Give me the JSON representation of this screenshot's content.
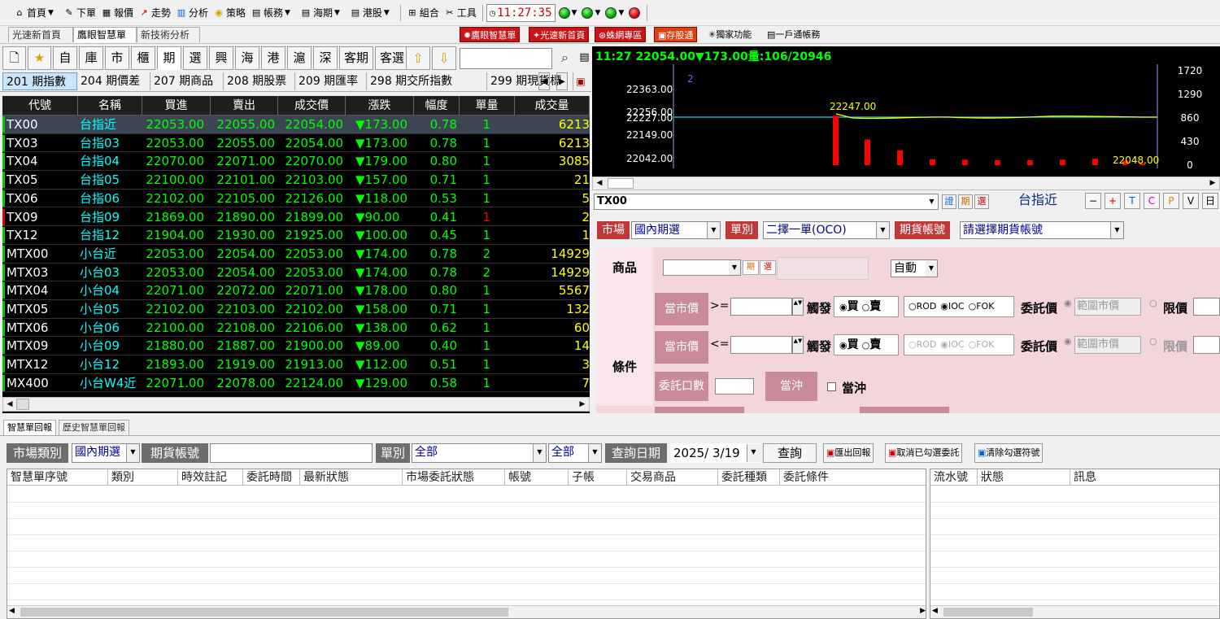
{
  "toolbar": {
    "items": [
      "首頁",
      "下單",
      "報價",
      "走勢",
      "分析",
      "策略",
      "帳務",
      "海期",
      "港股",
      "組合",
      "工具"
    ],
    "clock": "11:27:35"
  },
  "toolbar2": {
    "tabs": [
      "光速新首頁",
      "鷹眼智慧單",
      "新技術分析"
    ],
    "buttons": [
      "鷹眼智慧單",
      "光速新首頁",
      "蛛網專區",
      "存股通",
      "獨家功能",
      "一戶通帳務"
    ]
  },
  "nav": {
    "tabs": [
      "自",
      "庫",
      "市",
      "櫃",
      "期",
      "選",
      "興",
      "海",
      "港",
      "滬",
      "深",
      "客期",
      "客選"
    ],
    "subtabs": [
      "201 期指數",
      "204 期價差",
      "207 期商品",
      "208 期股票",
      "209 期匯率",
      "298 期交所指數",
      "299 期現貨標"
    ]
  },
  "quote_table": {
    "headers": [
      "代號",
      "名稱",
      "買進",
      "賣出",
      "成交價",
      "漲跌",
      "幅度",
      "單量",
      "成交量"
    ],
    "rows": [
      {
        "code": "TX00",
        "name": "台指近",
        "bid": "22053.00",
        "ask": "22055.00",
        "last": "22054.00",
        "chg": "▼173.00",
        "pct": "0.78",
        "qty": "1",
        "vol": "6213"
      },
      {
        "code": "TX03",
        "name": "台指03",
        "bid": "22053.00",
        "ask": "22055.00",
        "last": "22054.00",
        "chg": "▼173.00",
        "pct": "0.78",
        "qty": "1",
        "vol": "6213"
      },
      {
        "code": "TX04",
        "name": "台指04",
        "bid": "22070.00",
        "ask": "22071.00",
        "last": "22070.00",
        "chg": "▼179.00",
        "pct": "0.80",
        "qty": "1",
        "vol": "3085"
      },
      {
        "code": "TX05",
        "name": "台指05",
        "bid": "22100.00",
        "ask": "22101.00",
        "last": "22103.00",
        "chg": "▼157.00",
        "pct": "0.71",
        "qty": "1",
        "vol": "21"
      },
      {
        "code": "TX06",
        "name": "台指06",
        "bid": "22102.00",
        "ask": "22105.00",
        "last": "22126.00",
        "chg": "▼118.00",
        "pct": "0.53",
        "qty": "1",
        "vol": "5"
      },
      {
        "code": "TX09",
        "name": "台指09",
        "bid": "21869.00",
        "ask": "21890.00",
        "last": "21899.00",
        "chg": "▼90.00",
        "pct": "0.41",
        "qty": "1",
        "vol": "2"
      },
      {
        "code": "TX12",
        "name": "台指12",
        "bid": "21904.00",
        "ask": "21930.00",
        "last": "21925.00",
        "chg": "▼100.00",
        "pct": "0.45",
        "qty": "1",
        "vol": "1"
      },
      {
        "code": "MTX00",
        "name": "小台近",
        "bid": "22053.00",
        "ask": "22054.00",
        "last": "22053.00",
        "chg": "▼174.00",
        "pct": "0.78",
        "qty": "2",
        "vol": "14929"
      },
      {
        "code": "MTX03",
        "name": "小台03",
        "bid": "22053.00",
        "ask": "22054.00",
        "last": "22053.00",
        "chg": "▼174.00",
        "pct": "0.78",
        "qty": "2",
        "vol": "14929"
      },
      {
        "code": "MTX04",
        "name": "小台04",
        "bid": "22071.00",
        "ask": "22072.00",
        "last": "22071.00",
        "chg": "▼178.00",
        "pct": "0.80",
        "qty": "1",
        "vol": "5567"
      },
      {
        "code": "MTX05",
        "name": "小台05",
        "bid": "22102.00",
        "ask": "22103.00",
        "last": "22102.00",
        "chg": "▼158.00",
        "pct": "0.71",
        "qty": "1",
        "vol": "132"
      },
      {
        "code": "MTX06",
        "name": "小台06",
        "bid": "22100.00",
        "ask": "22108.00",
        "last": "22106.00",
        "chg": "▼138.00",
        "pct": "0.62",
        "qty": "1",
        "vol": "60"
      },
      {
        "code": "MTX09",
        "name": "小台09",
        "bid": "21880.00",
        "ask": "21887.00",
        "last": "21900.00",
        "chg": "▼89.00",
        "pct": "0.40",
        "qty": "1",
        "vol": "14"
      },
      {
        "code": "MTX12",
        "name": "小台12",
        "bid": "21893.00",
        "ask": "21919.00",
        "last": "21913.00",
        "chg": "▼112.00",
        "pct": "0.51",
        "qty": "1",
        "vol": "3"
      },
      {
        "code": "MX400",
        "name": "小台W4近",
        "bid": "22071.00",
        "ask": "22078.00",
        "last": "22124.00",
        "chg": "▼129.00",
        "pct": "0.58",
        "qty": "1",
        "vol": "7"
      }
    ]
  },
  "chart_data": {
    "type": "line",
    "header": "11:27  22054.00▼173.00量:106/20946",
    "marker": "2",
    "price_ticks": [
      "22363.00",
      "22256.00",
      "22227.00",
      "22149.00",
      "22042.00"
    ],
    "volume_ticks": [
      "1720",
      "1290",
      "860",
      "430",
      "0"
    ],
    "high_label": "22247.00",
    "low_label": "22048.00",
    "volume_bars": [
      1000,
      520,
      300,
      120,
      110,
      100,
      100,
      110,
      130,
      90,
      40
    ]
  },
  "order": {
    "symbol": "TX00",
    "symbol_btns": [
      "證",
      "期",
      "選"
    ],
    "symbol_name": "台指近",
    "icon_btns": [
      "−",
      "+",
      "T",
      "C",
      "P",
      "V",
      "日"
    ],
    "market_label": "市場",
    "market_value": "國內期選",
    "type_label": "單別",
    "type_value": "二擇一單(OCO)",
    "account_label": "期貨帳號",
    "account_value": "請選擇期貨帳號",
    "product_label": "商品",
    "product_btns": [
      "期",
      "選"
    ],
    "trigger_value": "自動",
    "cond_label": "條件",
    "row1": {
      "label": "當市價",
      "op": ">=",
      "trigger": "觸發",
      "buy": "買",
      "sell": "賣",
      "rod": "ROD",
      "ioc": "IOC",
      "fok": "FOK",
      "price_label": "委託價",
      "range": "範圍市價",
      "limit": "限價"
    },
    "row2": {
      "label": "當市價",
      "op": "<=",
      "trigger": "觸發",
      "buy": "買",
      "sell": "賣",
      "rod": "ROD",
      "ioc": "IOC",
      "fok": "FOK",
      "price_label": "委託價",
      "range": "範圍市價",
      "limit": "限價"
    },
    "qty_label": "委託口數",
    "daytrade_label": "當沖",
    "daytrade_check": "當沖"
  },
  "bottom": {
    "tabs": [
      "智慧單回報",
      "歷史智慧單回報"
    ],
    "market_label": "市場類別",
    "market_value": "國內期選",
    "account_label": "期貨帳號",
    "type_label": "單別",
    "type_value": "全部",
    "type2_value": "全部",
    "date_label": "查詢日期",
    "date_value": "2025/  3/19",
    "query_btn": "查詢",
    "export_btn": "匯出回報",
    "cancel_btn": "取消已勾選委託",
    "clear_btn": "清除勾選符號",
    "grid1_headers": [
      "智慧單序號",
      "類別",
      "時效註記",
      "委託時間",
      "最新狀態",
      "市場委託狀態",
      "帳號",
      "子帳",
      "交易商品",
      "委託種類",
      "委託條件"
    ],
    "grid2_headers": [
      "流水號",
      "狀態",
      "訊息"
    ]
  },
  "colors": {
    "green": "#00ff00",
    "yellow": "#ffff00",
    "cyan": "#00ffff",
    "red_label": "#c03838",
    "pink": "#f3d6dc"
  }
}
